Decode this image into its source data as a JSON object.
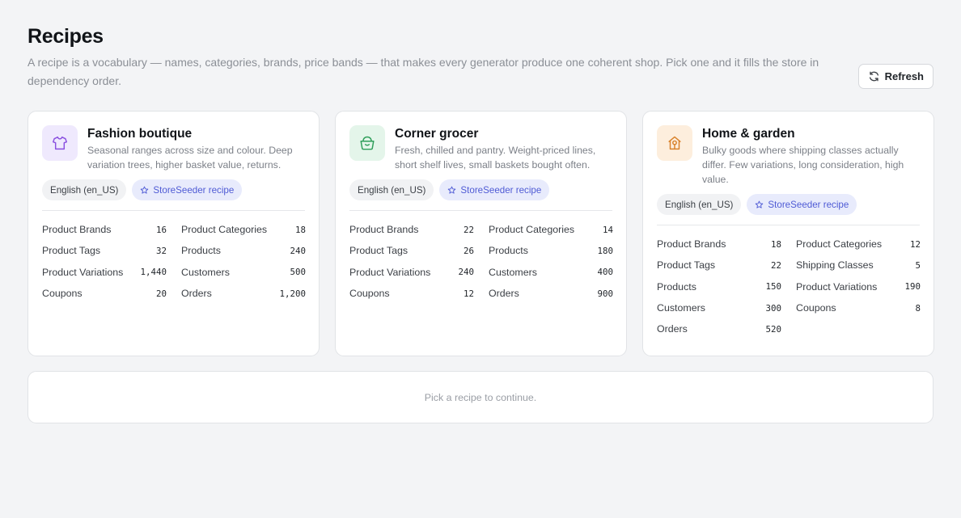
{
  "header": {
    "title": "Recipes",
    "description": "A recipe is a vocabulary — names, categories, brands, price bands — that makes every generator produce one coherent shop. Pick one and it fills the store in dependency order.",
    "refresh_label": "Refresh"
  },
  "colors": {
    "accent": "#4f5bd5",
    "chip_recipe_bg": "#e8ebfc"
  },
  "recipes": [
    {
      "title": "Fashion boutique",
      "description": "Seasonal ranges across size and colour. Deep variation trees, higher basket value, returns.",
      "icon": "tshirt-icon",
      "icon_bg": "#efe9fd",
      "icon_color": "#8a4fe0",
      "language": "English (en_US)",
      "badge": "StoreSeeder recipe",
      "stats": [
        {
          "label": "Product Brands",
          "value": "16"
        },
        {
          "label": "Product Categories",
          "value": "18"
        },
        {
          "label": "Product Tags",
          "value": "32"
        },
        {
          "label": "Products",
          "value": "240"
        },
        {
          "label": "Product Variations",
          "value": "1,440"
        },
        {
          "label": "Customers",
          "value": "500"
        },
        {
          "label": "Coupons",
          "value": "20"
        },
        {
          "label": "Orders",
          "value": "1,200"
        }
      ]
    },
    {
      "title": "Corner grocer",
      "description": "Fresh, chilled and pantry. Weight-priced lines, short shelf lives, small baskets bought often.",
      "icon": "basket-icon",
      "icon_bg": "#e4f5ea",
      "icon_color": "#2f9e5a",
      "language": "English (en_US)",
      "badge": "StoreSeeder recipe",
      "stats": [
        {
          "label": "Product Brands",
          "value": "22"
        },
        {
          "label": "Product Categories",
          "value": "14"
        },
        {
          "label": "Product Tags",
          "value": "26"
        },
        {
          "label": "Products",
          "value": "180"
        },
        {
          "label": "Product Variations",
          "value": "240"
        },
        {
          "label": "Customers",
          "value": "400"
        },
        {
          "label": "Coupons",
          "value": "12"
        },
        {
          "label": "Orders",
          "value": "900"
        }
      ]
    },
    {
      "title": "Home & garden",
      "description": "Bulky goods where shipping classes actually differ. Few variations, long consideration, high value.",
      "icon": "house-icon",
      "icon_bg": "#fdeedd",
      "icon_color": "#d9822b",
      "language": "English (en_US)",
      "badge": "StoreSeeder recipe",
      "stats": [
        {
          "label": "Product Brands",
          "value": "18"
        },
        {
          "label": "Product Categories",
          "value": "12"
        },
        {
          "label": "Product Tags",
          "value": "22"
        },
        {
          "label": "Shipping Classes",
          "value": "5"
        },
        {
          "label": "Products",
          "value": "150"
        },
        {
          "label": "Product Variations",
          "value": "190"
        },
        {
          "label": "Customers",
          "value": "300"
        },
        {
          "label": "Coupons",
          "value": "8"
        },
        {
          "label": "Orders",
          "value": "520"
        }
      ]
    }
  ],
  "status": {
    "message": "Pick a recipe to continue."
  }
}
